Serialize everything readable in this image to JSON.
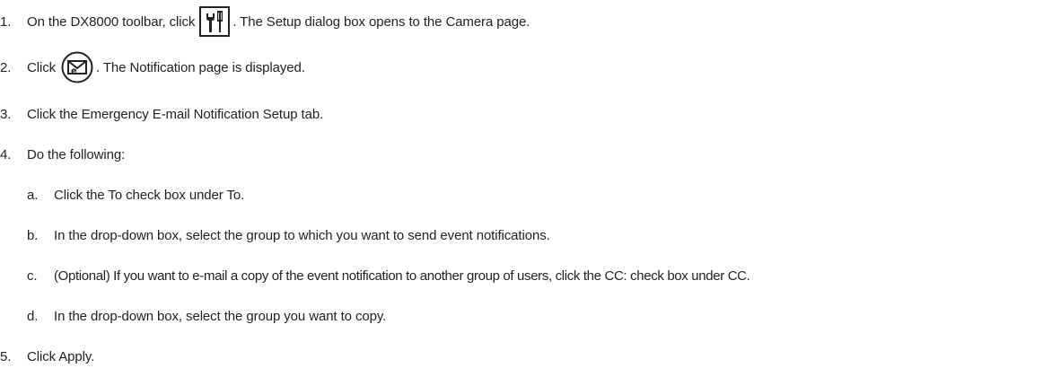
{
  "steps": [
    {
      "num": "1.",
      "text_before": "On the DX8000 toolbar, click",
      "icon": "setup-tools-icon",
      "text_after": ". The Setup dialog box opens to the Camera page."
    },
    {
      "num": "2.",
      "text_before": "Click",
      "icon": "notification-envelope-icon",
      "text_after": ". The Notification page is displayed."
    },
    {
      "num": "3.",
      "text": "Click the Emergency E-mail Notification Setup tab."
    },
    {
      "num": "4.",
      "text": "Do the following:",
      "substeps": [
        {
          "letter": "a.",
          "text": "Click the To check box under To."
        },
        {
          "letter": "b.",
          "text": "In the drop-down box, select the group to which you want to send event notifications."
        },
        {
          "letter": "c.",
          "text": "(Optional) If you want to e-mail a copy of the event notification to another group of users, click the CC: check box under CC."
        },
        {
          "letter": "d.",
          "text": "In the drop-down box, select the group you want to copy."
        }
      ]
    },
    {
      "num": "5.",
      "text": "Click Apply."
    }
  ]
}
